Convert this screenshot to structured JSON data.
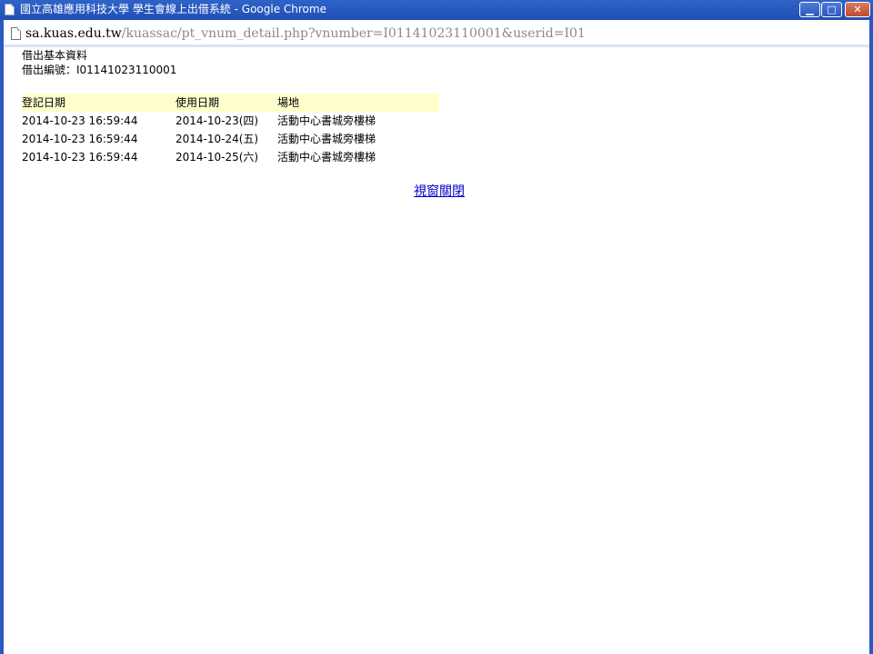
{
  "window": {
    "title": "國立高雄應用科技大學 學生會線上出借系統 - Google Chrome",
    "minimize_label": "▁",
    "maximize_label": "□",
    "close_label": "✕"
  },
  "address": {
    "host": "sa.kuas.edu.tw",
    "path": "/kuassac/pt_vnum_detail.php?vnumber=I01141023110001&userid=I01"
  },
  "page": {
    "heading": "借出基本資料",
    "serial_text": "借出編號：I01141023110001"
  },
  "table": {
    "headers": [
      "登記日期",
      "使用日期",
      "場地"
    ],
    "rows": [
      [
        "2014-10-23 16:59:44",
        "2014-10-23(四)",
        "活動中心書城旁樓梯"
      ],
      [
        "2014-10-23 16:59:44",
        "2014-10-24(五)",
        "活動中心書城旁樓梯"
      ],
      [
        "2014-10-23 16:59:44",
        "2014-10-25(六)",
        "活動中心書城旁樓梯"
      ]
    ]
  },
  "close_link": "視窗關閉",
  "colors": {
    "titlebar": "#2a5ac0",
    "header_row": "#ffffcc",
    "link": "#0000cc"
  }
}
